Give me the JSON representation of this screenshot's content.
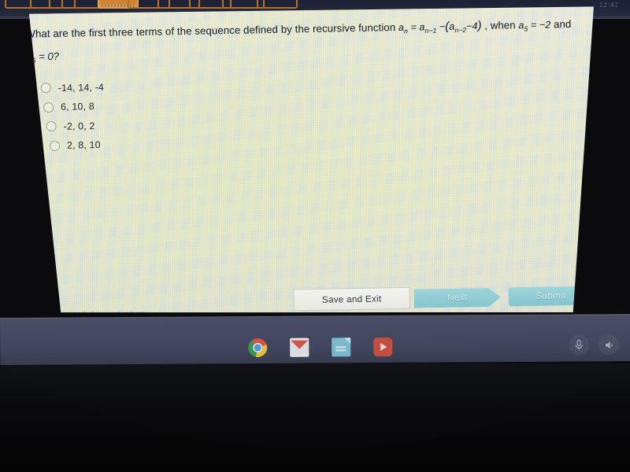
{
  "browser": {
    "tab_count": 9,
    "active_tab_index": 3,
    "clipped_top_text": "12:47"
  },
  "quiz": {
    "question_prefix": "What are the first three terms of the sequence defined by the recursive function",
    "formula": "a n = a n−1 − ( a n−2 − 4 )",
    "formula_parts": {
      "lhs_base": "a",
      "lhs_sub": "n",
      "eq": "=",
      "t1_base": "a",
      "t1_sub": "n−1",
      "minus": "−",
      "open": "(",
      "t2_base": "a",
      "t2_sub": "n−2",
      "minus2": "−",
      "four": "4",
      "close": ")"
    },
    "condition_lead": ", when",
    "condition_a5_base": "a",
    "condition_a5_sub": "5",
    "condition_a5_eq": "= −2",
    "condition_and": "and",
    "condition_a6_base": "a",
    "condition_a6_sub": "6",
    "condition_a6_eq": "= 0?",
    "options": [
      {
        "label": "-14, 14, -4",
        "selected": false
      },
      {
        "label": "6, 10, 8",
        "selected": false
      },
      {
        "label": "-2, 0, 2",
        "selected": false
      },
      {
        "label": "2, 8, 10",
        "selected": false
      }
    ]
  },
  "footer": {
    "mark_link": "Mark this and return",
    "save_label": "Save and Exit",
    "next_label": "Next",
    "submit_label": "Submit"
  },
  "shelf": {
    "apps": [
      {
        "name": "chrome",
        "label": "Chrome"
      },
      {
        "name": "gmail",
        "label": "Gmail"
      },
      {
        "name": "docs",
        "label": "Docs"
      },
      {
        "name": "youtube",
        "label": "YouTube"
      }
    ],
    "tray": [
      {
        "name": "microphone",
        "glyph": "Ἲ4"
      },
      {
        "name": "volume",
        "glyph": "ὐA"
      }
    ]
  },
  "colors": {
    "page_bg": "#e4e5d6",
    "shelf_bg": "#454a62",
    "accent_cyan": "#86c6cf",
    "tab_orange": "#d1832f",
    "link_blue": "#6f86b4",
    "text_dark": "#1f2430"
  }
}
